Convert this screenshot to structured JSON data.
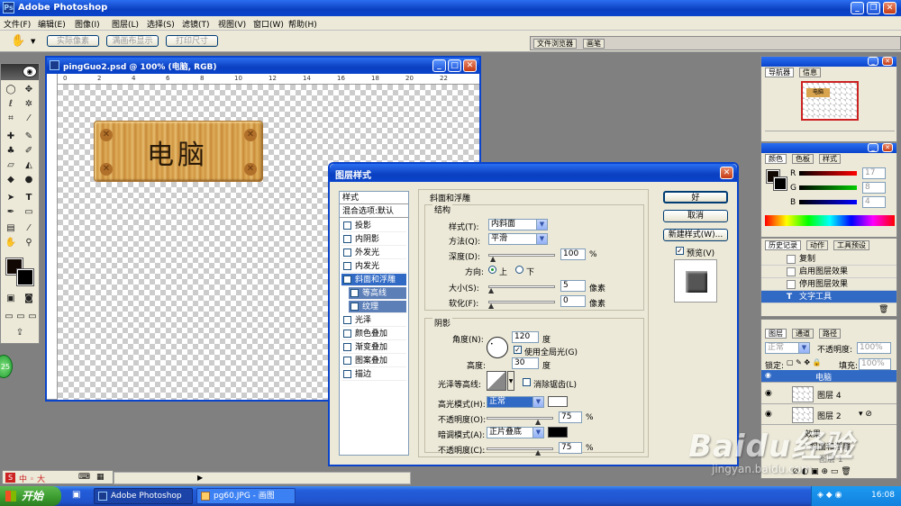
{
  "app": {
    "title": "Adobe Photoshop",
    "menu": [
      "文件(F)",
      "编辑(E)",
      "图像(I)",
      "图层(L)",
      "选择(S)",
      "滤镜(T)",
      "视图(V)",
      "窗口(W)",
      "帮助(H)"
    ]
  },
  "options_bar": {
    "buttons": [
      "实际像素",
      "满画布显示",
      "打印尺寸"
    ],
    "tabs": [
      "文件浏览器",
      "画笔"
    ]
  },
  "document": {
    "title": "pingGuo2.psd @ 100% (电脑, RGB)",
    "sign_text": "电脑",
    "ruler_ticks": [
      "0",
      "2",
      "4",
      "6",
      "8",
      "10",
      "12",
      "14",
      "16",
      "18",
      "20",
      "22"
    ]
  },
  "dialog": {
    "title": "图层样式",
    "styles_header": "样式",
    "blend_options": "混合选项:默认",
    "styles": [
      {
        "label": "投影",
        "checked": false
      },
      {
        "label": "内阴影",
        "checked": false
      },
      {
        "label": "外发光",
        "checked": false
      },
      {
        "label": "内发光",
        "checked": false
      },
      {
        "label": "斜面和浮雕",
        "checked": true
      },
      {
        "label": "等高线",
        "checked": false
      },
      {
        "label": "纹理",
        "checked": false
      },
      {
        "label": "光泽",
        "checked": false
      },
      {
        "label": "颜色叠加",
        "checked": false
      },
      {
        "label": "渐变叠加",
        "checked": false
      },
      {
        "label": "图案叠加",
        "checked": false
      },
      {
        "label": "描边",
        "checked": false
      }
    ],
    "section_title": "斜面和浮雕",
    "structure": {
      "title": "结构",
      "style_label": "样式(T):",
      "style_value": "内斜面",
      "technique_label": "方法(Q):",
      "technique_value": "平滑",
      "depth_label": "深度(D):",
      "depth_value": "100",
      "depth_unit": "%",
      "direction_label": "方向:",
      "dir_up": "上",
      "dir_down": "下",
      "size_label": "大小(S):",
      "size_value": "5",
      "size_unit": "像素",
      "soften_label": "软化(F):",
      "soften_value": "0",
      "soften_unit": "像素"
    },
    "shading": {
      "title": "阴影",
      "angle_label": "角度(N):",
      "angle_value": "120",
      "angle_unit": "度",
      "global_light": "使用全局光(G)",
      "altitude_label": "高度:",
      "altitude_value": "30",
      "altitude_unit": "度",
      "gloss_label": "光泽等高线:",
      "anti_alias": "消除锯齿(L)",
      "highlight_label": "高光模式(H):",
      "highlight_value": "正常",
      "highlight_color": "#ffffff",
      "hl_opacity_label": "不透明度(O):",
      "hl_opacity_value": "75",
      "hl_opacity_unit": "%",
      "shadow_label": "暗调模式(A):",
      "shadow_value": "正片叠底",
      "shadow_color": "#000000",
      "sh_opacity_label": "不透明度(C):",
      "sh_opacity_value": "75",
      "sh_opacity_unit": "%"
    },
    "buttons": {
      "ok": "好",
      "cancel": "取消",
      "new_style": "新建样式(W)...",
      "preview": "预览(V)"
    }
  },
  "navigator": {
    "tabs": [
      "导航器",
      "信息"
    ],
    "thumb_text": "电脑"
  },
  "color_panel": {
    "tabs": [
      "颜色",
      "色板",
      "样式"
    ],
    "r_label": "R",
    "g_label": "G",
    "b_label": "B",
    "r_value": "17",
    "g_value": "8",
    "b_value": "4"
  },
  "history": {
    "tabs": [
      "历史记录",
      "动作",
      "工具预设"
    ],
    "items": [
      "复制",
      "启用图层效果",
      "停用图层效果",
      "文字工具"
    ]
  },
  "layers": {
    "tabs": [
      "图层",
      "通道",
      "路径"
    ],
    "mode": "正常",
    "opacity_label": "不透明度:",
    "opacity_value": "100%",
    "lock_label": "锁定:",
    "fill_label": "填充:",
    "fill_value": "100%",
    "rows": [
      "电脑",
      "图层 4",
      "图层 2"
    ],
    "effects_label": "效果",
    "effect_item": "斜面和浮雕",
    "bottom_row": "图层 1"
  },
  "ime_bar": {
    "text": "中 ◦ 大"
  },
  "taskbar": {
    "start": "开始",
    "items": [
      "Adobe Photoshop",
      "pg60.JPG - 画图"
    ],
    "time": "16:08"
  },
  "watermark": {
    "main": "Baidu经验",
    "sub": "jingyan.baidu.com"
  },
  "badge": "25",
  "colors": {
    "xp_blue": "#0a44cc",
    "selection": "#316ac5",
    "dialog_bg": "#ece9d8",
    "wood": "#d9a44e"
  }
}
